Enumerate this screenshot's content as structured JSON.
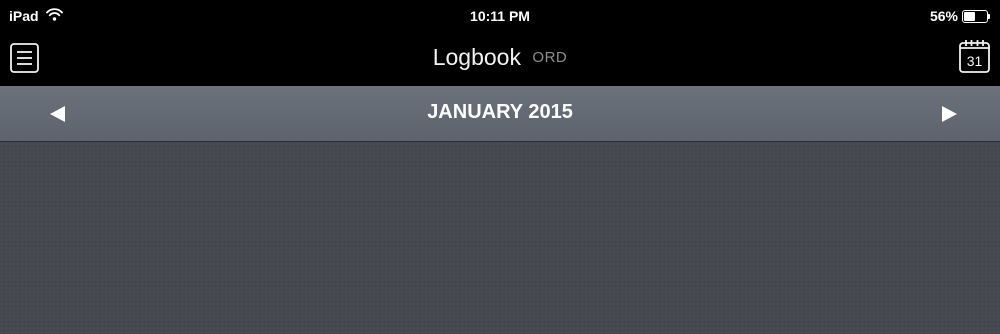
{
  "status_bar": {
    "device": "iPad",
    "time": "10:11 PM",
    "battery_percent": "56%",
    "battery_level": 0.56,
    "wifi_icon": "wifi-icon",
    "battery_icon": "battery-icon"
  },
  "nav": {
    "title": "Logbook",
    "subtitle": "ORD",
    "menu_icon": "menu-icon",
    "calendar_icon": "calendar-icon",
    "calendar_day": "31"
  },
  "month_bar": {
    "label": "JANUARY 2015",
    "prev_icon": "triangle-left-icon",
    "next_icon": "triangle-right-icon"
  },
  "colors": {
    "background": "#000000",
    "month_bar": "#636a73",
    "content": "#45484e",
    "subtitle": "#8e8e8e"
  }
}
